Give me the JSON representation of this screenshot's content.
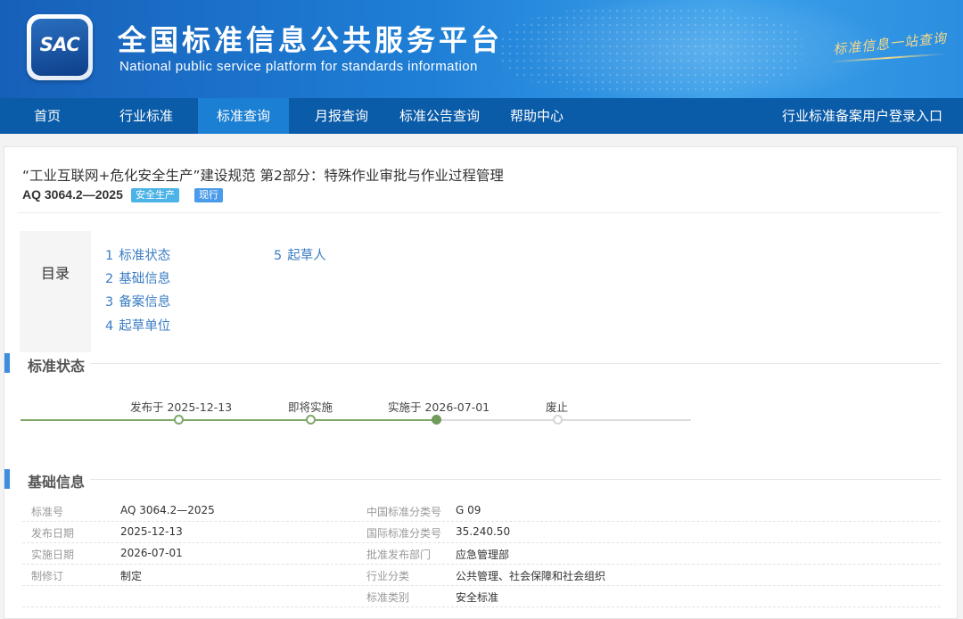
{
  "header": {
    "logo_text": "SAC",
    "title_cn": "全国标准信息公共服务平台",
    "title_en": "National public service platform  for standards information",
    "slogan": "标准信息一站查询"
  },
  "nav": {
    "items": [
      "首页",
      "行业标准",
      "标准查询",
      "月报查询",
      "标准公告查询",
      "帮助中心"
    ],
    "active": "标准查询",
    "login": "行业标准备案用户登录入口"
  },
  "doc": {
    "title": "“工业互联网+危化安全生产”建设规范 第2部分：特殊作业审批与作业过程管理",
    "code": "AQ 3064.2—2025",
    "tags": [
      "安全生产",
      "现行"
    ]
  },
  "toc": {
    "label": "目录",
    "items": [
      {
        "num": "1",
        "label": "标准状态"
      },
      {
        "num": "2",
        "label": "基础信息"
      },
      {
        "num": "3",
        "label": "备案信息"
      },
      {
        "num": "4",
        "label": "起草单位"
      },
      {
        "num": "5",
        "label": "起草人"
      }
    ]
  },
  "status": {
    "heading": "标准状态",
    "steps": [
      {
        "label": "发布于 2025-12-13",
        "state": "done"
      },
      {
        "label": "即将实施",
        "state": "done"
      },
      {
        "label": "实施于 2026-07-01",
        "state": "current"
      },
      {
        "label": "废止",
        "state": "pending"
      }
    ]
  },
  "basic": {
    "heading": "基础信息",
    "rows": [
      {
        "k1": "标准号",
        "v1": "AQ 3064.2—2025",
        "k2": "中国标准分类号",
        "v2": "G 09"
      },
      {
        "k1": "发布日期",
        "v1": "2025-12-13",
        "k2": "国际标准分类号",
        "v2": "35.240.50"
      },
      {
        "k1": "实施日期",
        "v1": "2026-07-01",
        "k2": "批准发布部门",
        "v2": "应急管理部"
      },
      {
        "k1": "制修订",
        "v1": "制定",
        "k2": "行业分类",
        "v2": "公共管理、社会保障和社会组织"
      },
      {
        "k1": "",
        "v1": "",
        "k2": "标准类别",
        "v2": "安全标准"
      }
    ]
  },
  "colors": {
    "header_blue": "#1f7fd6",
    "nav_blue": "#0a5ba8",
    "nav_active": "#1b7fd3",
    "link": "#3b7dc4",
    "timeline_green": "#7fa86a",
    "tag_category": "#4cb3e6",
    "tag_status": "#4a9bea"
  }
}
